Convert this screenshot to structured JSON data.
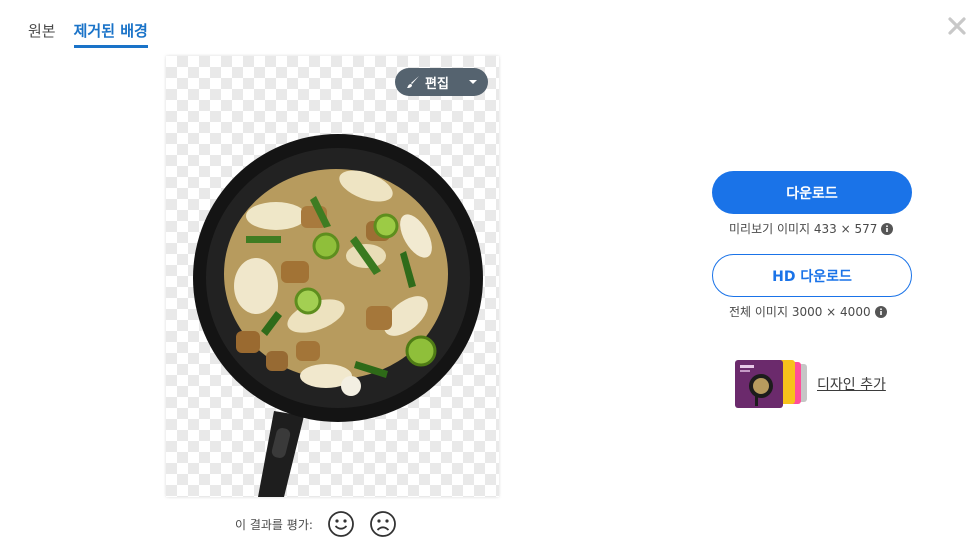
{
  "tabs": [
    {
      "label": "원본",
      "active": false
    },
    {
      "label": "제거된 배경",
      "active": true
    }
  ],
  "close_icon": "close-icon",
  "editor": {
    "edit_label": "편집",
    "brush_icon": "brush-icon",
    "caret_icon": "chevron-down-icon"
  },
  "rating": {
    "label": "이 결과를 평가:",
    "good_icon": "smile-icon",
    "bad_icon": "frown-icon"
  },
  "download": {
    "label": "다운로드",
    "info": "미리보기 이미지 433 × 577"
  },
  "hd_download": {
    "label": "HD 다운로드",
    "info": "전체 이미지 3000 × 4000"
  },
  "design": {
    "label": "디자인 추가"
  },
  "colors": {
    "accent": "#1a73e8",
    "edit_bg": "#55636f"
  }
}
